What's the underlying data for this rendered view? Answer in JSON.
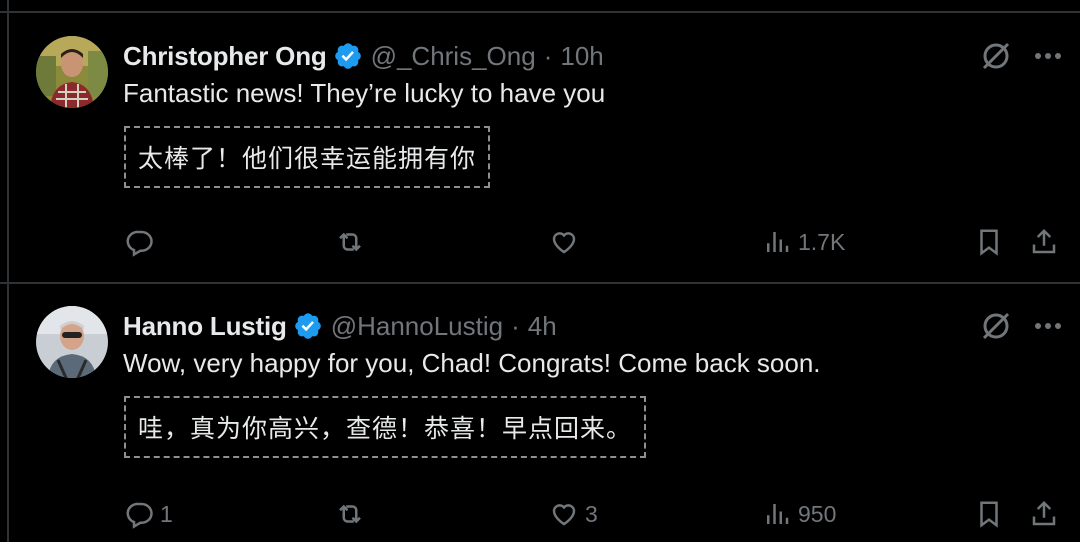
{
  "tweets": [
    {
      "display_name": "Christopher Ong",
      "handle": "@_Chris_Ong",
      "separator": "·",
      "time": "10h",
      "text": "Fantastic news! They’re lucky to have you",
      "translation": "太棒了！他们很幸运能拥有你",
      "replies": "",
      "reposts": "",
      "likes": "",
      "views": "1.7K",
      "avatar_icon": "person-photo-icon"
    },
    {
      "display_name": "Hanno Lustig",
      "handle": "@HannoLustig",
      "separator": "·",
      "time": "4h",
      "text": "Wow, very happy for you, Chad! Congrats! Come back soon.",
      "translation": "哇，真为你高兴，查德！恭喜！早点回来。",
      "replies": "1",
      "reposts": "",
      "likes": "3",
      "views": "950",
      "avatar_icon": "person-photo-icon"
    }
  ],
  "colors": {
    "background": "#000000",
    "text_primary": "#e7e9ea",
    "text_secondary": "#71767b",
    "verified_badge": "#1d9bf0",
    "divider": "#2f3336"
  }
}
